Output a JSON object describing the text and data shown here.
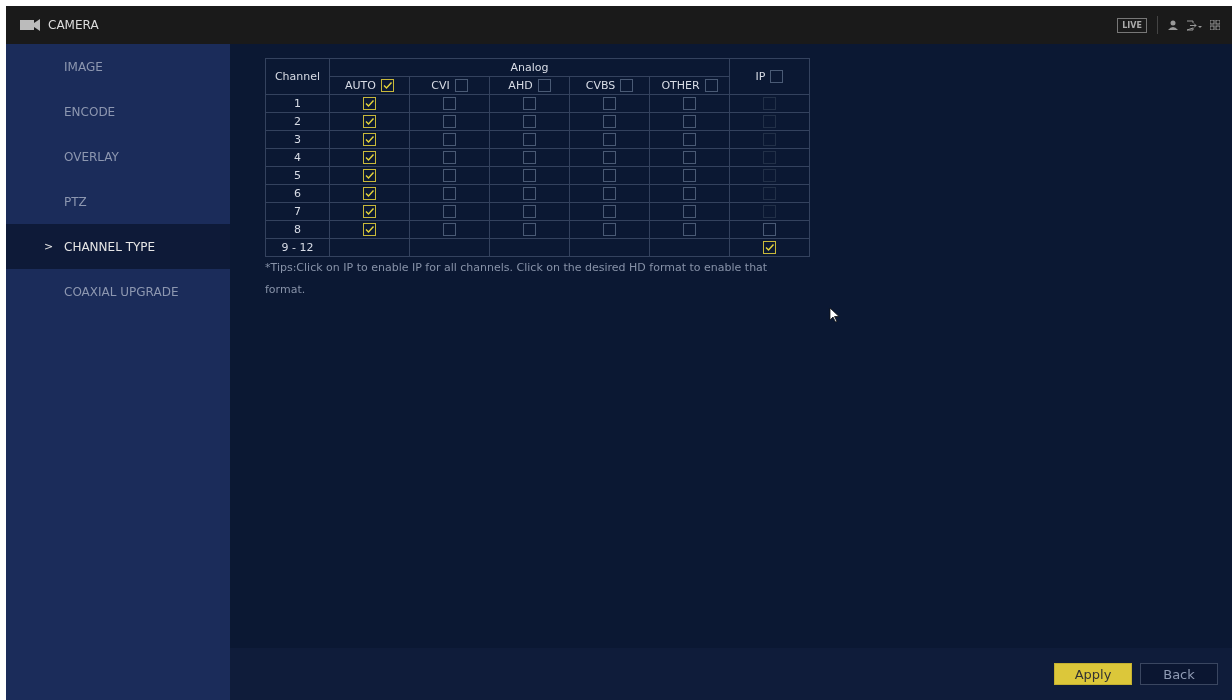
{
  "header": {
    "title": "CAMERA",
    "live_badge": "LIVE"
  },
  "sidebar": {
    "items": [
      {
        "label": "IMAGE",
        "selected": false
      },
      {
        "label": "ENCODE",
        "selected": false
      },
      {
        "label": "OVERLAY",
        "selected": false
      },
      {
        "label": "PTZ",
        "selected": false
      },
      {
        "label": "CHANNEL TYPE",
        "selected": true,
        "marker": ">"
      },
      {
        "label": "COAXIAL UPGRADE",
        "selected": false
      }
    ]
  },
  "table": {
    "channel_header": "Channel",
    "analog_header": "Analog",
    "columns": [
      {
        "label": "AUTO",
        "checked": true
      },
      {
        "label": "CVI",
        "checked": false
      },
      {
        "label": "AHD",
        "checked": false
      },
      {
        "label": "CVBS",
        "checked": false
      },
      {
        "label": "OTHER",
        "checked": false
      }
    ],
    "ip_column": {
      "label": "IP",
      "checked": false
    },
    "rows": [
      {
        "channel": "1",
        "analog": [
          {
            "checked": true
          },
          {
            "checked": false
          },
          {
            "checked": false
          },
          {
            "checked": false
          },
          {
            "checked": false
          }
        ],
        "ip": {
          "checked": false,
          "disabled": true
        }
      },
      {
        "channel": "2",
        "analog": [
          {
            "checked": true
          },
          {
            "checked": false
          },
          {
            "checked": false
          },
          {
            "checked": false
          },
          {
            "checked": false
          }
        ],
        "ip": {
          "checked": false,
          "disabled": true
        }
      },
      {
        "channel": "3",
        "analog": [
          {
            "checked": true
          },
          {
            "checked": false
          },
          {
            "checked": false
          },
          {
            "checked": false
          },
          {
            "checked": false
          }
        ],
        "ip": {
          "checked": false,
          "disabled": true
        }
      },
      {
        "channel": "4",
        "analog": [
          {
            "checked": true
          },
          {
            "checked": false
          },
          {
            "checked": false
          },
          {
            "checked": false
          },
          {
            "checked": false
          }
        ],
        "ip": {
          "checked": false,
          "disabled": true
        }
      },
      {
        "channel": "5",
        "analog": [
          {
            "checked": true
          },
          {
            "checked": false
          },
          {
            "checked": false
          },
          {
            "checked": false
          },
          {
            "checked": false
          }
        ],
        "ip": {
          "checked": false,
          "disabled": true
        }
      },
      {
        "channel": "6",
        "analog": [
          {
            "checked": true
          },
          {
            "checked": false
          },
          {
            "checked": false
          },
          {
            "checked": false
          },
          {
            "checked": false
          }
        ],
        "ip": {
          "checked": false,
          "disabled": true
        }
      },
      {
        "channel": "7",
        "analog": [
          {
            "checked": true
          },
          {
            "checked": false
          },
          {
            "checked": false
          },
          {
            "checked": false
          },
          {
            "checked": false
          }
        ],
        "ip": {
          "checked": false,
          "disabled": true
        }
      },
      {
        "channel": "8",
        "analog": [
          {
            "checked": true
          },
          {
            "checked": false
          },
          {
            "checked": false
          },
          {
            "checked": false
          },
          {
            "checked": false
          }
        ],
        "ip": {
          "checked": false,
          "disabled": false
        }
      },
      {
        "channel": "9 - 12",
        "ip": {
          "checked": true,
          "disabled": false
        }
      }
    ]
  },
  "tip": "*Tips:Click on IP to enable IP for all channels. Click on the desired HD format to enable that format.",
  "buttons": [
    {
      "label": "Apply",
      "kind": "primary"
    },
    {
      "label": "Back",
      "kind": "secondary"
    }
  ]
}
